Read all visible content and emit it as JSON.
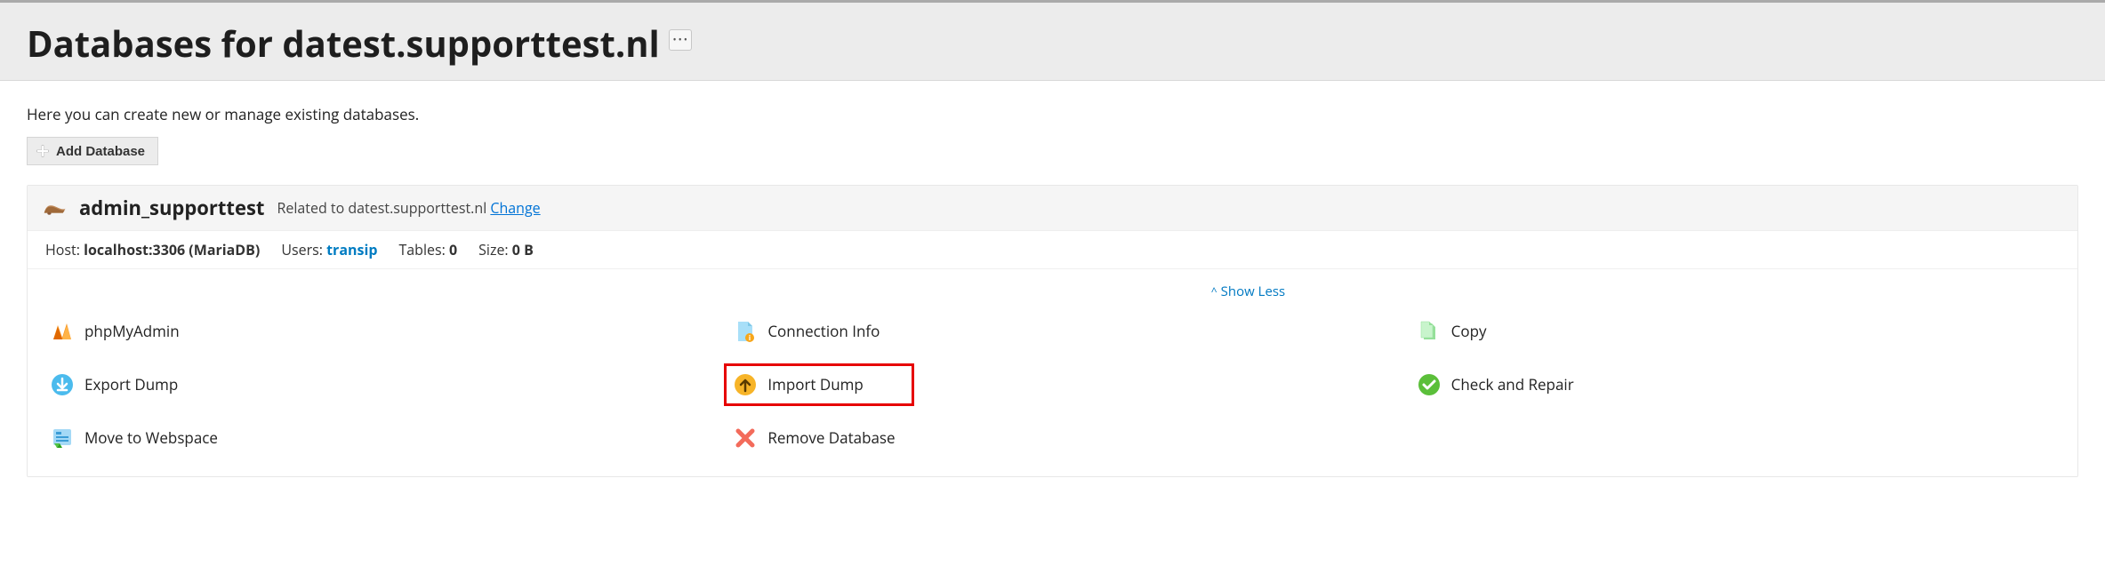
{
  "header": {
    "title": "Databases for datest.supporttest.nl",
    "ellipsis": "…"
  },
  "intro": "Here you can create new or manage existing databases.",
  "toolbar": {
    "add_label": "Add Database"
  },
  "database": {
    "name": "admin_supporttest",
    "related_prefix": "Related to ",
    "related_value": "datest.supporttest.nl",
    "change_label": "Change",
    "meta": {
      "host_label": "Host:",
      "host_value": "localhost:3306 (MariaDB)",
      "users_label": "Users:",
      "users_value": "transip",
      "tables_label": "Tables:",
      "tables_value": "0",
      "size_label": "Size:",
      "size_value": "0 B"
    },
    "show_less": "Show Less"
  },
  "actions": {
    "phpmyadmin": "phpMyAdmin",
    "connection_info": "Connection Info",
    "copy": "Copy",
    "export_dump": "Export Dump",
    "import_dump": "Import Dump",
    "check_repair": "Check and Repair",
    "move_webspace": "Move to Webspace",
    "remove": "Remove Database"
  }
}
